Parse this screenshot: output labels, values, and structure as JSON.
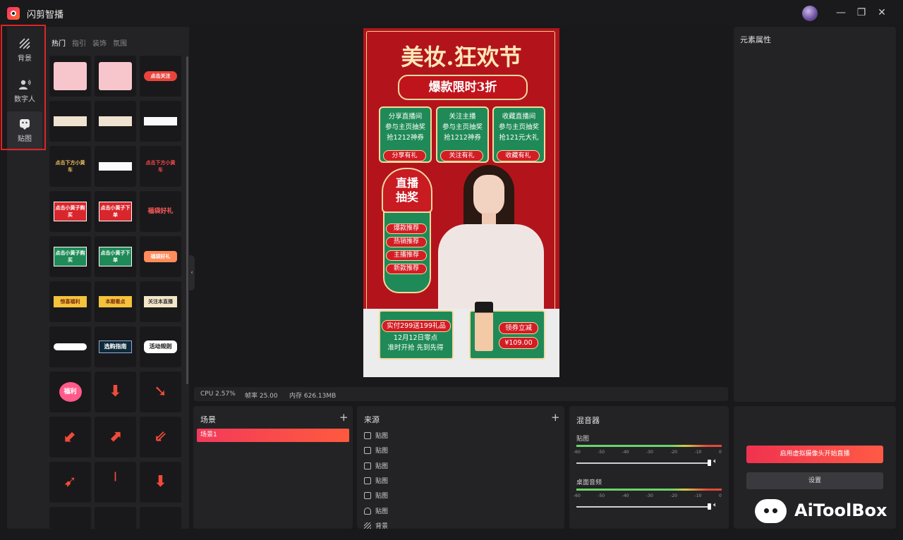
{
  "app": {
    "title": "闪剪智播"
  },
  "window": {
    "minimize": "—",
    "restore": "❐",
    "close": "✕"
  },
  "rail": {
    "items": [
      {
        "label": "背景",
        "icon": "background-icon"
      },
      {
        "label": "数字人",
        "icon": "digital-human-icon"
      },
      {
        "label": "贴图",
        "icon": "sticker-icon"
      }
    ]
  },
  "sticker_panel": {
    "tabs": [
      "热门",
      "指引",
      "装饰",
      "氛围"
    ],
    "active_tab": "热门",
    "tiles": [
      {
        "text": "",
        "kind": "pink-card"
      },
      {
        "text": "",
        "kind": "pink-card-2"
      },
      {
        "text": "点击关注",
        "kind": "red-pill"
      },
      {
        "text": "",
        "kind": "cream-strip"
      },
      {
        "text": "",
        "kind": "cream-strip-2"
      },
      {
        "text": "",
        "kind": "white-strip"
      },
      {
        "text": "点击下方小黄车",
        "kind": "text-dark"
      },
      {
        "text": "",
        "kind": "white-bar"
      },
      {
        "text": "点击下方小黄车",
        "kind": "text-red"
      },
      {
        "text": "点击小黄子购买",
        "kind": "red-sign"
      },
      {
        "text": "点击小黄子下单",
        "kind": "red-sign"
      },
      {
        "text": "福袋好礼",
        "kind": "arrow-text"
      },
      {
        "text": "点击小黄子购买",
        "kind": "green-sign"
      },
      {
        "text": "点击小黄子下单",
        "kind": "green-sign"
      },
      {
        "text": "福袋好礼",
        "kind": "orange-badge"
      },
      {
        "text": "惊喜福利",
        "kind": "yellow-ribbon"
      },
      {
        "text": "本期看点",
        "kind": "yellow-ribbon-2"
      },
      {
        "text": "关注本直播",
        "kind": "cream-ribbon"
      },
      {
        "text": "",
        "kind": "white-pill"
      },
      {
        "text": "选购指南",
        "kind": "guide"
      },
      {
        "text": "活动规则",
        "kind": "rules"
      },
      {
        "text": "福利",
        "kind": "heart"
      },
      {
        "text": "",
        "kind": "arrow-down-red"
      },
      {
        "text": "",
        "kind": "arrow-curve"
      },
      {
        "text": "",
        "kind": "arrow-diag-pink"
      },
      {
        "text": "",
        "kind": "arrow-diag-red"
      },
      {
        "text": "",
        "kind": "arrow-outline"
      },
      {
        "text": "",
        "kind": "arrow-orange"
      },
      {
        "text": "",
        "kind": "arrow-thin"
      },
      {
        "text": "",
        "kind": "arrow-down-small"
      },
      {
        "text": "",
        "kind": "partial"
      },
      {
        "text": "",
        "kind": "partial"
      },
      {
        "text": "",
        "kind": "partial"
      }
    ]
  },
  "preview": {
    "title": "美妆.狂欢节",
    "subtitle": "爆款限时3折",
    "cards": [
      {
        "lines": [
          "分享直播间",
          "参与主页抽奖",
          "抢1212神券"
        ],
        "button": "分享有礼"
      },
      {
        "lines": [
          "关注主播",
          "参与主页抽奖",
          "抢1212神券"
        ],
        "button": "关注有礼"
      },
      {
        "lines": [
          "收藏直播间",
          "参与主页抽奖",
          "抢121元大礼"
        ],
        "button": "收藏有礼"
      }
    ],
    "lottery": {
      "title": [
        "直播",
        "抽奖"
      ],
      "items": [
        "爆款推荐",
        "热销推荐",
        "主播推荐",
        "新款推荐"
      ]
    },
    "promo": {
      "pill": "实付299送199礼品",
      "lines": [
        "12月12日零点",
        "准时开抢 先到先得"
      ]
    },
    "coupon": {
      "label": "领券立减",
      "price": "¥109.00"
    }
  },
  "status": {
    "cpu": "CPU 2.57%",
    "fps": "帧率 25.00",
    "mem": "内存 626.13MB"
  },
  "props": {
    "title": "元素属性"
  },
  "scene": {
    "title": "场景",
    "add": "+",
    "items": [
      "场景1"
    ]
  },
  "sources": {
    "title": "来源",
    "add": "+",
    "items": [
      {
        "label": "贴图",
        "icon": "sticker-icon"
      },
      {
        "label": "贴图",
        "icon": "sticker-icon"
      },
      {
        "label": "贴图",
        "icon": "sticker-icon"
      },
      {
        "label": "贴图",
        "icon": "sticker-icon"
      },
      {
        "label": "贴图",
        "icon": "sticker-icon"
      },
      {
        "label": "贴图",
        "icon": "person-icon"
      },
      {
        "label": "背景",
        "icon": "background-icon"
      }
    ]
  },
  "mixer": {
    "title": "混音器",
    "ticks": [
      "-60",
      "-50",
      "-40",
      "-30",
      "-20",
      "-10",
      "0"
    ],
    "channels": [
      {
        "name": "贴图",
        "level": 1.0
      },
      {
        "name": "桌面音频",
        "level": 1.0
      }
    ]
  },
  "actions": {
    "start": "启用虚拟摄像头开始直播",
    "settings": "设置"
  },
  "watermark": {
    "text": "AiToolBox"
  }
}
